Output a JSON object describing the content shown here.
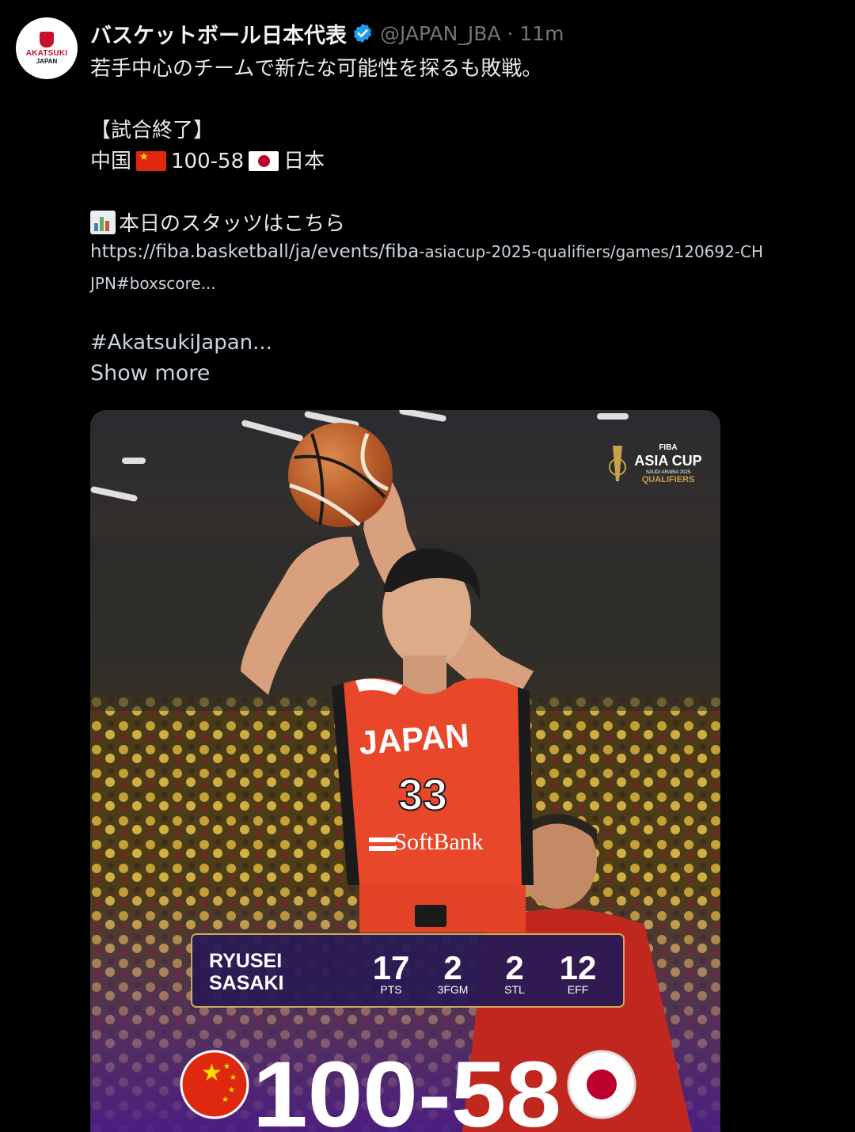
{
  "account": {
    "avatar_text_line1": "AKATSUKI",
    "avatar_text_line2": "JAPAN",
    "display_name": "バスケットボール日本代表",
    "handle": "@JAPAN_JBA",
    "time": "· 11m"
  },
  "post": {
    "line1": "若手中心のチームで新たな可能性を探るも敗戦。",
    "line2": "【試合終了】",
    "score_team1": "中国",
    "score_value": "100-58",
    "score_team2": "日本",
    "stats_line": "本日のスタッツはこちら",
    "link_part1": "https://fiba.basketball/ja/events/fiba",
    "link_part2": "-asiacup-2025-qualifiers/games/120692-CH",
    "link_line2": "JPN#boxscore...",
    "hashtag": "#AkatsukiJapan...",
    "show_more": "Show more"
  },
  "media": {
    "logo_fiba": "FIBA",
    "logo_title": "ASIA CUP",
    "logo_sub": "SAUDI ARABIA 2025",
    "logo_qualifiers": "QUALIFIERS",
    "jersey_team": "JAPAN",
    "jersey_number": "33",
    "jersey_sponsor": "SoftBank",
    "player_first": "RYUSEI",
    "player_last": "SASAKI",
    "stats": [
      {
        "value": "17",
        "label": "PTS"
      },
      {
        "value": "2",
        "label": "3FGM"
      },
      {
        "value": "2",
        "label": "STL"
      },
      {
        "value": "12",
        "label": "EFF"
      }
    ],
    "final_score": "100-58"
  },
  "colors": {
    "link": "#c9d4df",
    "verified": "#1d9bf0",
    "jersey": "#e8472a",
    "stat_panel": "#2a1a55",
    "stat_border": "#d4b15a"
  },
  "icons": [
    "verified-badge-icon",
    "bar-chart-emoji-icon",
    "china-flag-icon",
    "japan-flag-icon"
  ]
}
